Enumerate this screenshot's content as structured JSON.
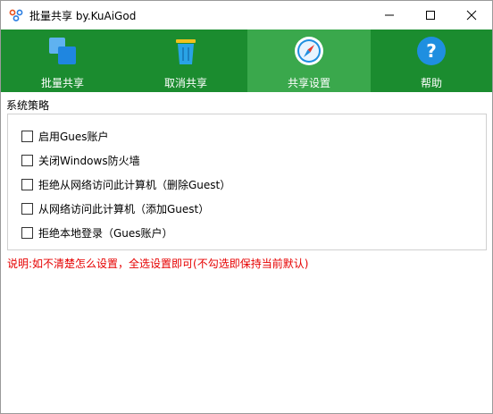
{
  "window": {
    "title": "批量共享 by.KuAiGod"
  },
  "toolbar": {
    "tabs": [
      {
        "label": "批量共享",
        "icon": "squares-icon"
      },
      {
        "label": "取消共享",
        "icon": "trash-icon"
      },
      {
        "label": "共享设置",
        "icon": "compass-icon",
        "selected": true
      },
      {
        "label": "帮助",
        "icon": "help-icon"
      }
    ],
    "colors": {
      "bar": "#1b8c2f",
      "selected": "#3aa84c"
    }
  },
  "panel": {
    "section_title": "系统策略",
    "options": [
      {
        "label": "启用Gues账户",
        "checked": false
      },
      {
        "label": "关闭Windows防火墙",
        "checked": false
      },
      {
        "label": "拒绝从网络访问此计算机（删除Guest）",
        "checked": false
      },
      {
        "label": "从网络访问此计算机（添加Guest）",
        "checked": false
      },
      {
        "label": "拒绝本地登录（Gues账户）",
        "checked": false
      }
    ],
    "note": "说明:如不清楚怎么设置，全选设置即可(不勾选即保持当前默认)",
    "note_color": "#e60000"
  }
}
